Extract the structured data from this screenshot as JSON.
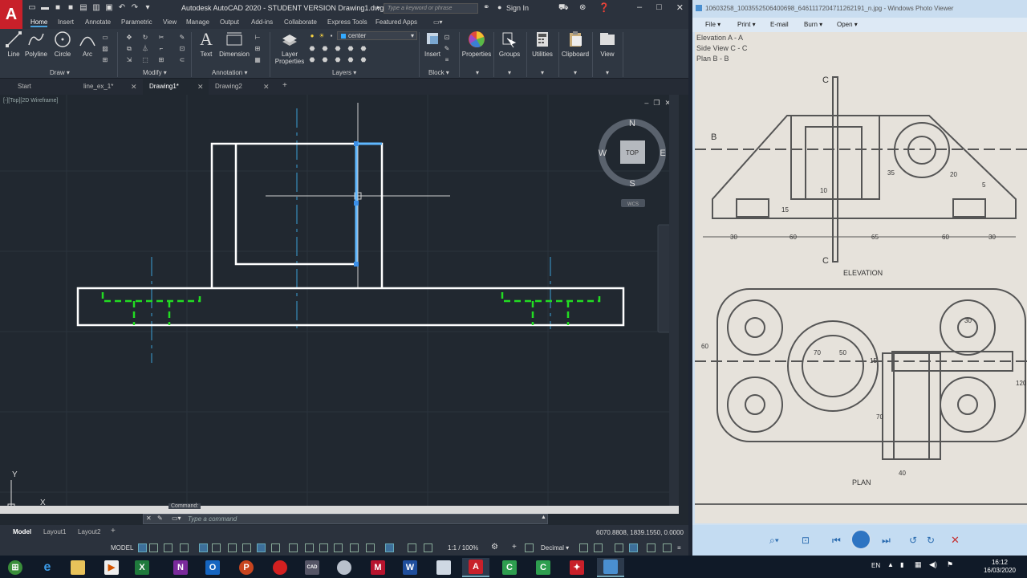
{
  "app": {
    "title": "Autodesk AutoCAD 2020 - STUDENT VERSION    Drawing1.dwg",
    "logo": "A",
    "search_placeholder": "Type a keyword or phrase",
    "sign_in": "Sign In"
  },
  "menu": [
    "Home",
    "Insert",
    "Annotate",
    "Parametric",
    "View",
    "Manage",
    "Output",
    "Add-ins",
    "Collaborate",
    "Express Tools",
    "Featured Apps"
  ],
  "ribbon": {
    "draw_tools": [
      "Line",
      "Polyline",
      "Circle",
      "Arc"
    ],
    "draw_label": "Draw",
    "modify_label": "Modify",
    "annotation_tools": [
      "Text",
      "Dimension"
    ],
    "annotation_label": "Annotation",
    "layer_properties": "Layer\nProperties",
    "layer_current": "center",
    "layers_label": "Layers",
    "insert": "Insert",
    "block_label": "Block",
    "right_tools": [
      "Properties",
      "Groups",
      "Utilities",
      "Clipboard",
      "View"
    ]
  },
  "file_tabs": [
    {
      "label": "Start",
      "active": false
    },
    {
      "label": "line_ex_1*",
      "active": false
    },
    {
      "label": "Drawing1*",
      "active": true
    },
    {
      "label": "Drawing2",
      "active": false
    }
  ],
  "viewport": {
    "label": "[-][Top][2D Wireframe]",
    "viewcube": {
      "north": "N",
      "south": "S",
      "east": "E",
      "west": "W",
      "face": "TOP",
      "wcs": "WCS"
    },
    "ucs_y": "Y",
    "ucs_x": "X"
  },
  "command": {
    "tag": "Command:",
    "placeholder": "Type a command"
  },
  "layout_tabs": [
    "Model",
    "Layout1",
    "Layout2"
  ],
  "coordinates": "6070.8808, 1839.1550, 0.0000",
  "status": {
    "model": "MODEL",
    "scale": "1:1 / 100%",
    "units": "Decimal"
  },
  "photo_viewer": {
    "title": "10603258_1003552506400698_6461117204711262191_n.jpg - Windows Photo Viewer",
    "menu": [
      "File",
      "Print",
      "E-mail",
      "Burn",
      "Open"
    ],
    "labels": {
      "legend1": "Elevation  A - A",
      "legend2": "Side View  C - C",
      "legend3": "Plan B - B",
      "elevation": "ELEVATION",
      "plan": "PLAN",
      "sec_b": "B",
      "sec_c": "C",
      "dims": [
        "30",
        "60",
        "65",
        "60",
        "30",
        "10",
        "15",
        "35",
        "20",
        "5",
        "70",
        "40",
        "70",
        "50",
        "30",
        "60",
        "60",
        "120",
        "15"
      ]
    }
  },
  "taskbar": {
    "lang": "EN",
    "time": "16:12",
    "date": "16/03/2020"
  },
  "colors": {
    "acad_bg": "#212830",
    "dashed_green": "#22dd22",
    "selected_blue": "#33aaff",
    "center_line": "#3399cc"
  }
}
